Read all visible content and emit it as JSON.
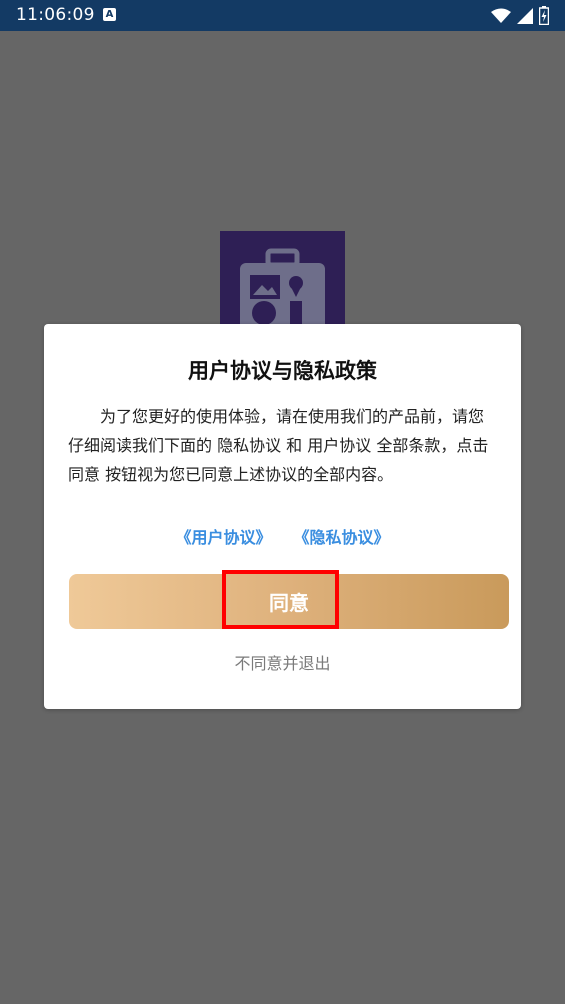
{
  "status_bar": {
    "time": "11:06:09",
    "notification_icon": "A",
    "icons": [
      "wifi-icon",
      "signal-icon",
      "battery-charging-icon"
    ]
  },
  "background": {
    "logo_icon": "toolbox-logo-icon"
  },
  "dialog": {
    "title": "用户协议与隐私政策",
    "body": "为了您更好的使用体验，请在使用我们的产品前，请您仔细阅读我们下面的 隐私协议 和 用户协议 全部条款，点击 同意 按钮视为您已同意上述协议的全部内容。",
    "links": {
      "user_agreement": "《用户协议》",
      "privacy_agreement": "《隐私协议》"
    },
    "agree_label": "同意",
    "decline_label": "不同意并退出"
  },
  "colors": {
    "status_bar": "#133a64",
    "overlay": "#666666",
    "link": "#3a8ee0",
    "button_gradient_start": "#efc998",
    "button_gradient_end": "#c99a5b",
    "highlight": "#ff0000"
  }
}
